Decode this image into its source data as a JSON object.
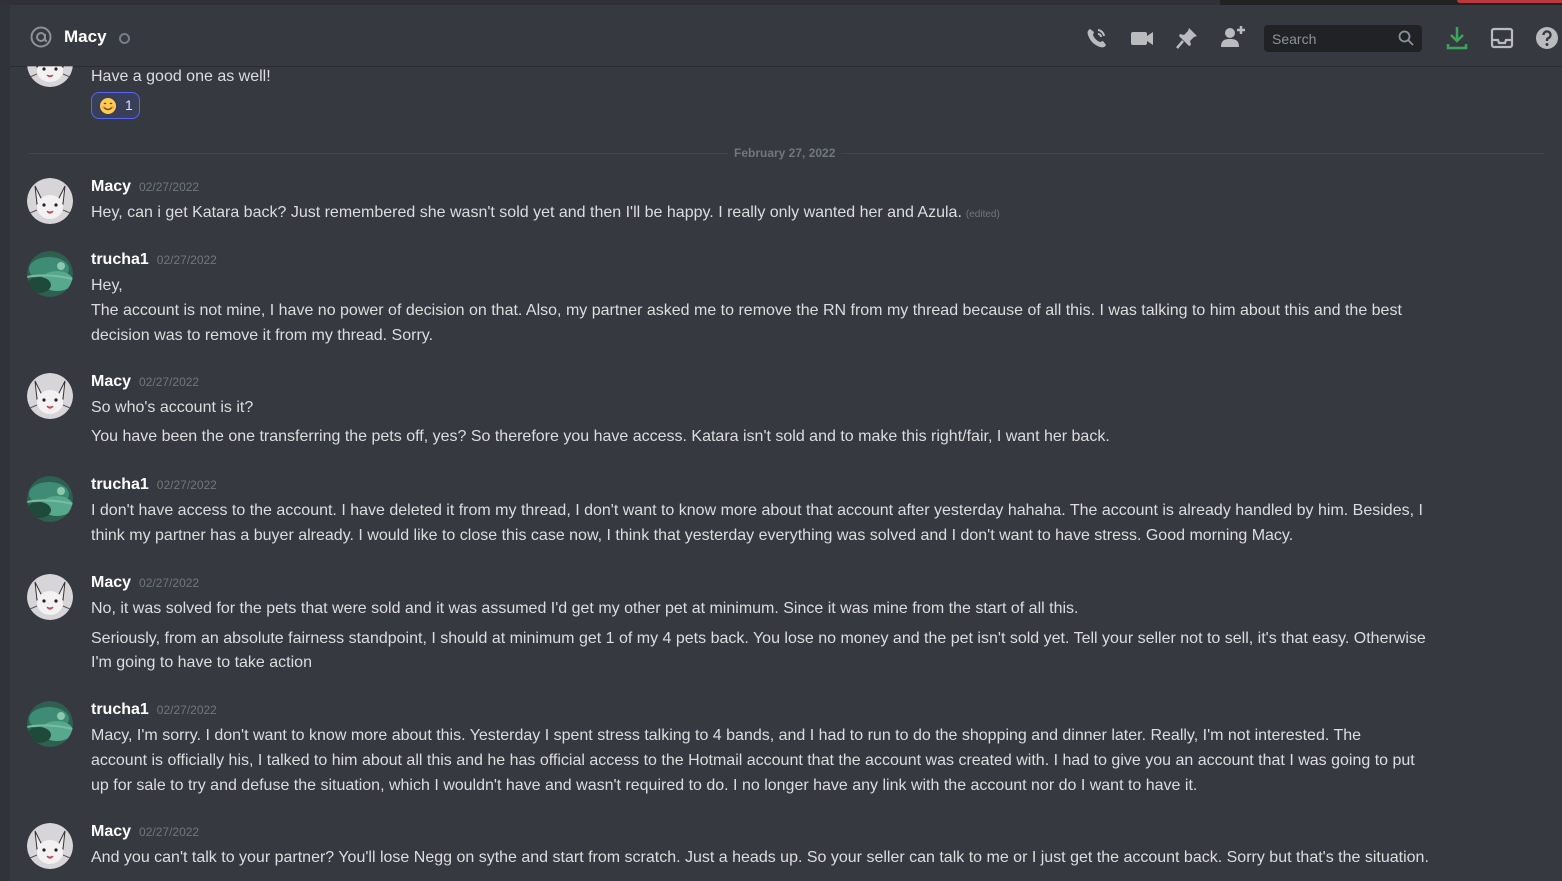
{
  "header": {
    "channel_name": "Macy",
    "search_placeholder": "Search"
  },
  "top_message": {
    "text": "Have a good one as well!",
    "reaction_count": "1"
  },
  "date_divider": "February 27, 2022",
  "messages": [
    {
      "author": "Macy",
      "timestamp": "02/27/2022",
      "lines": [
        "Hey, can i get Katara back? Just remembered she wasn't sold yet and then I'll be happy. I really only wanted her and Azula."
      ],
      "edited": "(edited)"
    },
    {
      "author": "trucha1",
      "timestamp": "02/27/2022",
      "lines": [
        "Hey,",
        "The account is not mine, I have no power of decision on that.  Also, my partner asked me to remove the RN from my thread because of all this. I was talking to him about this and the best",
        "decision was to remove it from my thread. Sorry."
      ]
    },
    {
      "author": "Macy",
      "timestamp": "02/27/2022",
      "lines": [
        "So who's account is it?",
        "You have been the one transferring the pets off, yes? So therefore you have access. Katara isn't sold and to make this right/fair, I want her back."
      ]
    },
    {
      "author": "trucha1",
      "timestamp": "02/27/2022",
      "lines": [
        "I don't have access to the account.  I have deleted it from my thread, I don't want to know more about that account after yesterday hahaha.  The account is already handled by him.  Besides, I",
        "think my partner has a buyer already.  I would like to close this case now, I think that yesterday everything was solved and I don't want to have stress.  Good morning Macy."
      ]
    },
    {
      "author": "Macy",
      "timestamp": "02/27/2022",
      "lines": [
        "No, it was solved for the pets that were sold and it was assumed I'd get my other pet at minimum. Since it was mine from the start of all this.",
        "Seriously, from an absolute fairness standpoint, I should at minimum get 1 of my 4 pets back. You lose no money and the pet isn't sold yet. Tell your seller not to sell, it's that easy. Otherwise",
        "I'm going to have to take action"
      ]
    },
    {
      "author": "trucha1",
      "timestamp": "02/27/2022",
      "lines": [
        "Macy, I'm sorry.  I don't want to know more about this.  Yesterday I spent stress talking to 4 bands, and I had to run to do the shopping and dinner later.  Really, I'm not interested.  The",
        "account is officially his, I talked to him about all this and he has official access to the Hotmail account that the account was created with.  I had to give you an account that I was going to put",
        "up for sale to try and defuse the situation, which I wouldn't have and wasn't required to do.  I no longer have any link with the account nor do I want to have it."
      ]
    },
    {
      "author": "Macy",
      "timestamp": "02/27/2022",
      "lines": [
        "And you can't talk to your partner? You'll lose Negg on sythe and start from scratch. Just a heads up.  So your seller can talk to me or I just get the account back.  Sorry but that's the situation."
      ]
    }
  ],
  "colors": {
    "background": "#36393f",
    "header_text": "#ffffff",
    "message_text": "#dcddde",
    "timestamp": "#72767d",
    "download_icon": "#3ba55d",
    "reaction_border": "#5865f2"
  },
  "icons": [
    "at-icon",
    "status-icon",
    "phone-call-icon",
    "video-call-icon",
    "pin-icon",
    "add-friend-icon",
    "search-icon",
    "download-icon",
    "inbox-icon",
    "help-icon",
    "emoji-icon"
  ]
}
